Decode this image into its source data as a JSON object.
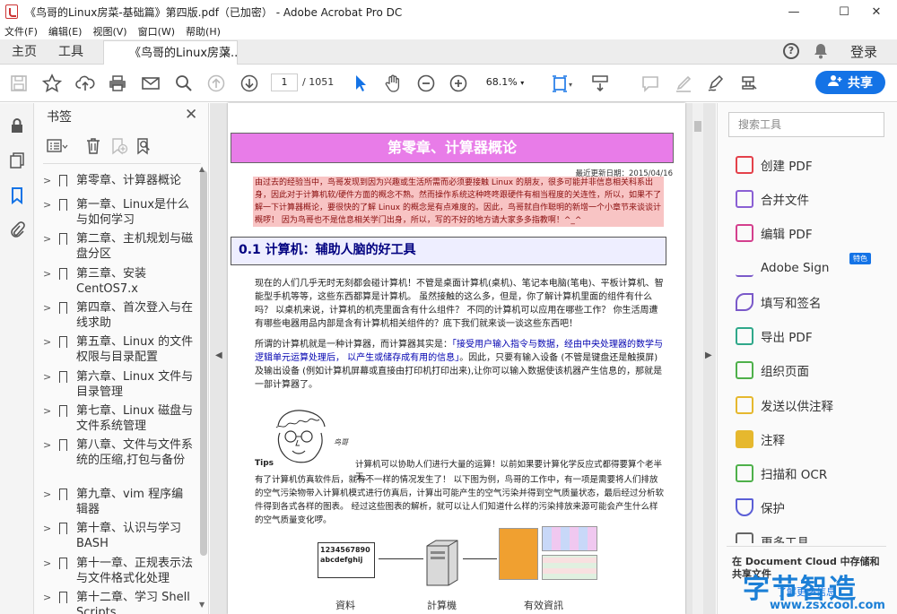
{
  "window": {
    "title": "《鸟哥的Linux房菜-基础篇》第四版.pdf（已加密） - Adobe Acrobat Pro DC",
    "minimize": "—",
    "maximize": "☐",
    "close": "✕"
  },
  "menu": [
    "文件(F)",
    "编辑(E)",
    "视图(V)",
    "窗口(W)",
    "帮助(H)"
  ],
  "tabs": {
    "home": "主页",
    "tools": "工具",
    "doc": "《鸟哥的Linux房菜...",
    "help": "?",
    "login": "登录"
  },
  "toolbar": {
    "page_current": "1",
    "page_total": "/ 1051",
    "zoom": "68.1%",
    "share_label": "共享"
  },
  "bookmarks": {
    "title": "书签",
    "items": [
      "第零章、计算器概论",
      "第一章、Linux是什么与如何学习",
      "第二章、主机规划与磁盘分区",
      "第三章、安装 CentOS7.x",
      "第四章、首次登入与在线求助",
      "第五章、Linux 的文件权限与目录配置",
      "第六章、Linux 文件与目录管理",
      "第七章、Linux 磁盘与文件系统管理",
      "第八章、文件与文件系统的压缩,打包与备份",
      "第九章、vim 程序编辑器",
      "第十章、认识与学习BASH",
      "第十一章、正规表示法与文件格式化处理",
      "第十二章、学习 Shell Scripts"
    ]
  },
  "document": {
    "chapter_title": "第零章、计算器概论",
    "updated": "最近更新日期：2015/04/16",
    "intro": "由过去的经验当中，鸟哥发现到因为兴趣或生活所需而必须要接触 Linux 的朋友，很多可能并非信息相关科系出身，因此对于计算机软/硬件方面的概念不熟。然而操作系统这种咚咚跟硬件有相当程度的关连性，所以，如果不了解一下计算器概论，要很快的了解 Linux 的概念是有点难度的。因此，鸟哥就自作聪明的新增一个小章节来谈谈计概啰！ 因为鸟哥也不是信息相关学门出身，所以，写的不好的地方请大家多多指教啊！^_^",
    "section_title": "0.1 计算机：辅助人脑的好工具",
    "para1": "现在的人们几乎无时无刻都会碰计算机！不管是桌面计算机(桌机)、笔记本电脑(笔电)、平板计算机、智能型手机等等，这些东西都算是计算机。 虽然接触的这么多，但是，你了解计算机里面的组件有什么吗？ 以桌机来说，计算机的机壳里面含有什么组件？ 不同的计算机可以应用在哪些工作？ 你生活周遭有哪些电器用品内部是含有计算机相关组件的？底下我们就来谈一谈这些东西吧！",
    "para2a": "所谓的计算机就是一种计算器，而计算器其实是：",
    "para2b": "「接受用户输入指令与数据，经由中央处理器的数学与逻辑单元运算处理后， 以产生或储存成有用的信息」",
    "para2c": "。因此，只要有输入设备 (不管是键盘还是触摸屏) 及输出设备 (例如计算机屏幕或直接由打印机打印出来),让你可以输入数据使该机器产生信息的，那就是一部计算器了。",
    "tips_label": "Tips",
    "tips_text": "计算机可以协助人们进行大量的运算！以前如果要计算化学反应式都得要算个老半天,",
    "para3": "有了计算机仿真软件后，就有不一样的情况发生了！ 以下图为例，鸟哥的工作中，有一项是需要将人们排放的空气污染物带入计算机模式进行仿真后，计算出可能产生的空气污染并得到空气质量状态，最后经过分析软件得到各式各样的图表。 经过这些图表的解析，就可以让人们知道什么样的污染排放来源可能会产生什么样的空气质量变化啰。",
    "fig_input": "1234567890\nabcdefghij",
    "fig_captions": [
      "資料",
      "計算機",
      "有效資訊"
    ],
    "avatar_caption": "鸟哥"
  },
  "tools_pane": {
    "search_placeholder": "搜索工具",
    "items": [
      {
        "label": "创建 PDF",
        "color": "#e4414a"
      },
      {
        "label": "合并文件",
        "color": "#8a5fd4"
      },
      {
        "label": "编辑 PDF",
        "color": "#d43f8d"
      },
      {
        "label": "Adobe Sign",
        "color": "#7a59c9"
      },
      {
        "label": "填写和签名",
        "color": "#7a59c9"
      },
      {
        "label": "导出 PDF",
        "color": "#2fa88a"
      },
      {
        "label": "组织页面",
        "color": "#4eb04a"
      },
      {
        "label": "发送以供注释",
        "color": "#e6b82e"
      },
      {
        "label": "注释",
        "color": "#e6b82e"
      },
      {
        "label": "扫描和 OCR",
        "color": "#4eb04a"
      },
      {
        "label": "保护",
        "color": "#5b5ed6"
      },
      {
        "label": "更多工具",
        "color": "#666666"
      }
    ],
    "badge": "特色",
    "cloud_note": "在 Document Cloud 中存储和共享文件",
    "cloud_link": "了解更多信息"
  },
  "watermark": {
    "big": "字节智造",
    "small": "www.zsxcool.com"
  }
}
